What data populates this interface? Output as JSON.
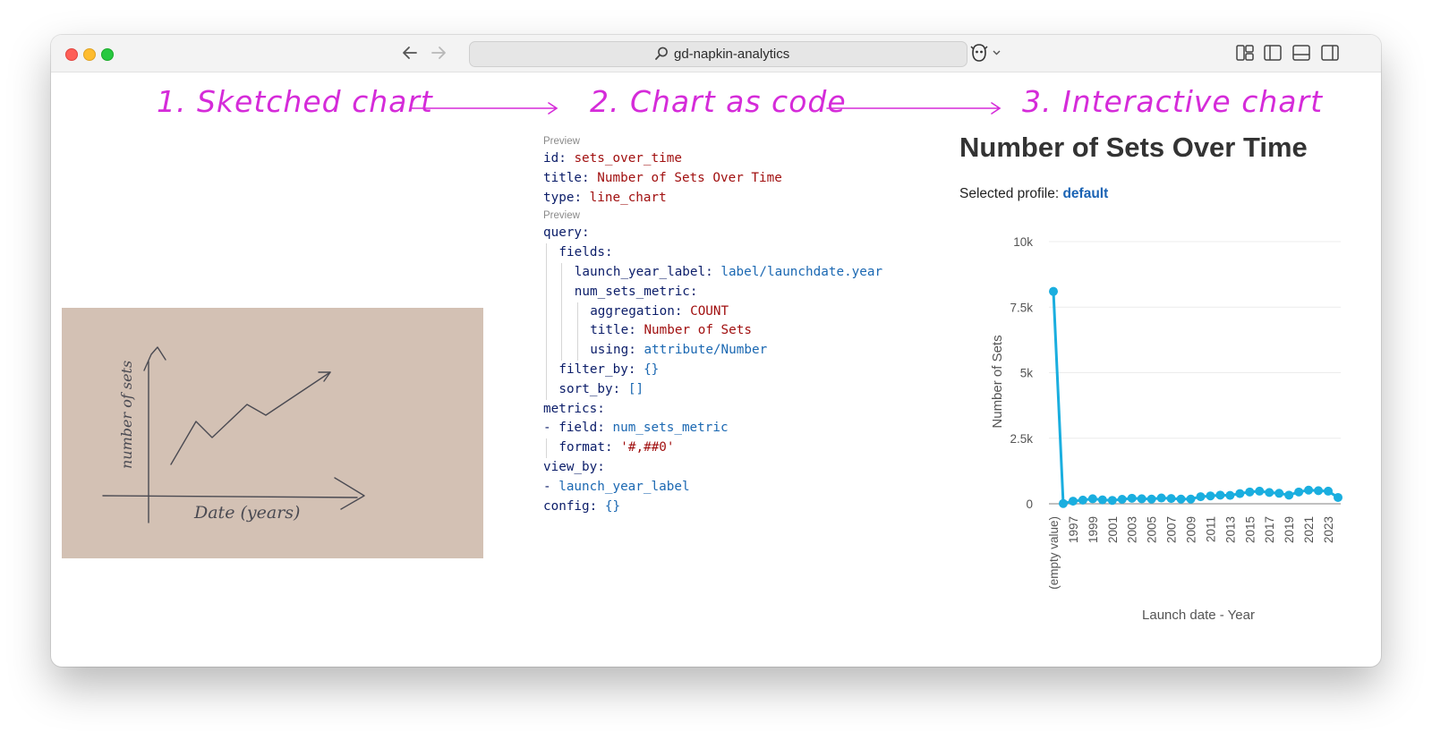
{
  "browser": {
    "url": "gd-napkin-analytics"
  },
  "steps": [
    {
      "label": "1. Sketched chart"
    },
    {
      "label": "2. Chart as code"
    },
    {
      "label": "3. Interactive chart"
    }
  ],
  "sketch": {
    "ylabel": "number of sets",
    "xlabel": "Date (years)"
  },
  "code": {
    "preview_label": "Preview",
    "lines": [
      {
        "preview": true
      },
      {
        "indent": 0,
        "key": "id",
        "value": "sets_over_time",
        "vclass": "s"
      },
      {
        "indent": 0,
        "key": "title",
        "value": "Number of Sets Over Time",
        "vclass": "s"
      },
      {
        "indent": 0,
        "key": "type",
        "value": "line_chart",
        "vclass": "s"
      },
      {
        "preview": true
      },
      {
        "indent": 0,
        "key": "query",
        "value": "",
        "vclass": "s"
      },
      {
        "indent": 1,
        "key": "fields",
        "value": "",
        "vclass": "s"
      },
      {
        "indent": 2,
        "key": "launch_year_label",
        "value": "label/launchdate.year",
        "vclass": "b"
      },
      {
        "indent": 2,
        "key": "num_sets_metric",
        "value": "",
        "vclass": "s"
      },
      {
        "indent": 3,
        "key": "aggregation",
        "value": "COUNT",
        "vclass": "s"
      },
      {
        "indent": 3,
        "key": "title",
        "value": "Number of Sets",
        "vclass": "s"
      },
      {
        "indent": 3,
        "key": "using",
        "value": "attribute/Number",
        "vclass": "b"
      },
      {
        "indent": 1,
        "key": "filter_by",
        "value": "{}",
        "vclass": "b"
      },
      {
        "indent": 1,
        "key": "sort_by",
        "value": "[]",
        "vclass": "b"
      },
      {
        "indent": 0,
        "key": "metrics",
        "value": "",
        "vclass": "s"
      },
      {
        "indent": 0,
        "dash": true,
        "key": "field",
        "value": "num_sets_metric",
        "vclass": "b"
      },
      {
        "indent": 1,
        "key": "format",
        "value": "'#,##0'",
        "vclass": "s"
      },
      {
        "indent": 0,
        "key": "view_by",
        "value": "",
        "vclass": "s"
      },
      {
        "indent": 0,
        "dash": true,
        "key": "",
        "value": "launch_year_label",
        "vclass": "b"
      },
      {
        "indent": 0,
        "key": "config",
        "value": "{}",
        "vclass": "b"
      }
    ]
  },
  "chart_panel": {
    "title": "Number of Sets Over Time",
    "profile_label": "Selected profile:",
    "profile_value": "default"
  },
  "chart_data": {
    "type": "line",
    "title": "Number of Sets Over Time",
    "xlabel": "Launch date - Year",
    "ylabel": "Number of Sets",
    "ylim": [
      0,
      10000
    ],
    "yticks": [
      0,
      2500,
      5000,
      7500,
      10000
    ],
    "ytick_labels": [
      "0",
      "2.5k",
      "5k",
      "7.5k",
      "10k"
    ],
    "categories": [
      "(empty value)",
      "1996",
      "1997",
      "1998",
      "1999",
      "2000",
      "2001",
      "2002",
      "2003",
      "2004",
      "2005",
      "2006",
      "2007",
      "2008",
      "2009",
      "2010",
      "2011",
      "2012",
      "2013",
      "2014",
      "2015",
      "2016",
      "2017",
      "2018",
      "2019",
      "2020",
      "2021",
      "2022",
      "2023",
      "2024"
    ],
    "visible_tick_labels": [
      "(empty value)",
      "1997",
      "1999",
      "2001",
      "2003",
      "2005",
      "2007",
      "2009",
      "2011",
      "2013",
      "2015",
      "2017",
      "2019",
      "2021",
      "2023"
    ],
    "series": [
      {
        "name": "Number of Sets",
        "color": "#1aaedf",
        "values": [
          8100,
          10,
          100,
          140,
          190,
          150,
          130,
          170,
          210,
          190,
          180,
          220,
          200,
          180,
          180,
          270,
          300,
          330,
          320,
          390,
          450,
          480,
          430,
          400,
          330,
          450,
          520,
          500,
          480,
          240
        ]
      }
    ],
    "grid": true
  },
  "colors": {
    "accent_step": "#d52bd9",
    "line": "#1aaedf",
    "profile_link": "#1a63b4",
    "code_key": "#0b1d69",
    "code_string": "#a11010",
    "code_ref": "#1b68b2"
  }
}
